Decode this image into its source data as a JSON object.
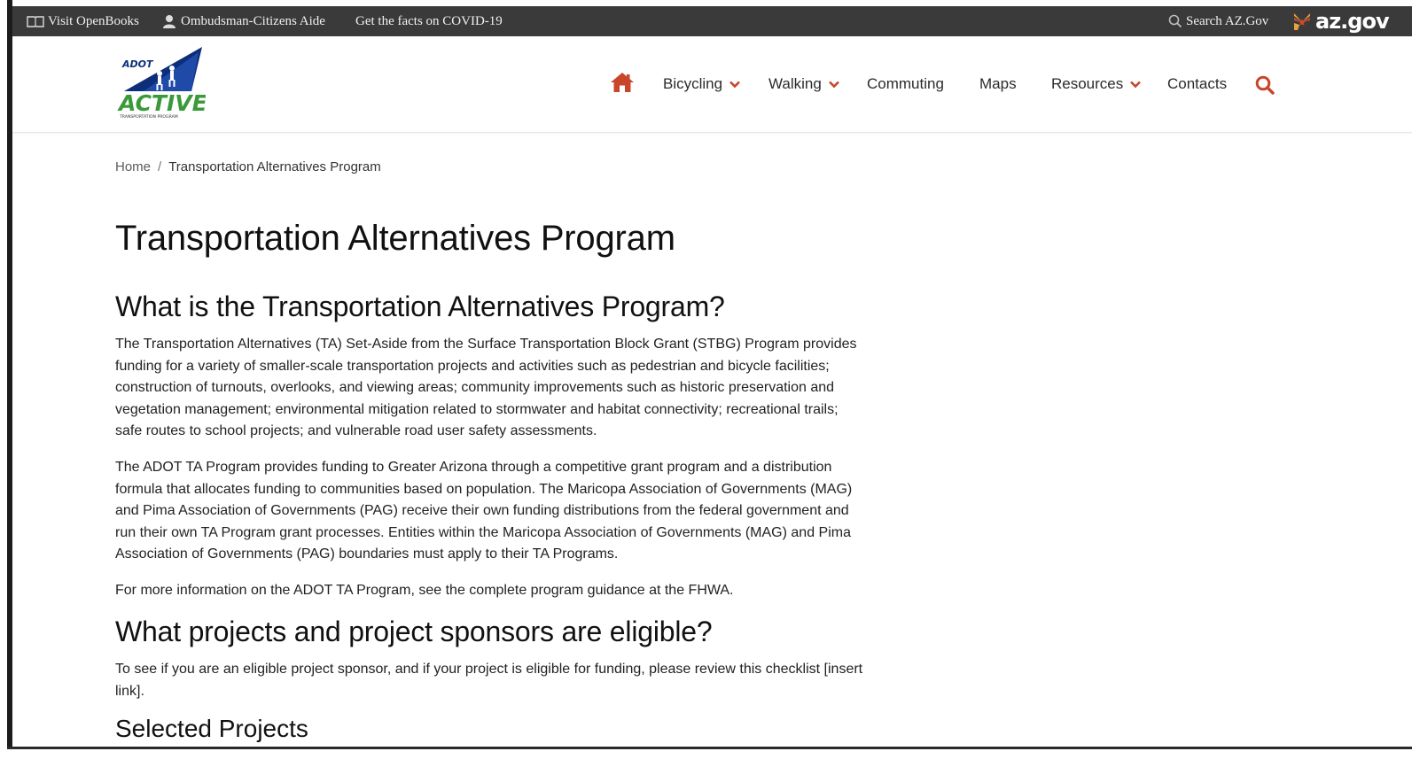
{
  "topbar": {
    "openbooks": "Visit OpenBooks",
    "ombudsman": "Ombudsman-Citizens Aide",
    "covid": "Get the facts on COVID-19",
    "search": "Search AZ.Gov",
    "azgov": "az.gov"
  },
  "logo": {
    "top": "ADOT",
    "main": "ACTIVE",
    "tagline": "TRANSPORTATION PROGRAM"
  },
  "nav": {
    "home_icon": "home-icon",
    "items": [
      {
        "label": "Bicycling",
        "dropdown": true
      },
      {
        "label": "Walking",
        "dropdown": true
      },
      {
        "label": "Commuting",
        "dropdown": false
      },
      {
        "label": "Maps",
        "dropdown": false
      },
      {
        "label": "Resources",
        "dropdown": true
      },
      {
        "label": "Contacts",
        "dropdown": false
      }
    ],
    "search_icon": "search-icon",
    "accent_color": "#c8462a"
  },
  "breadcrumb": {
    "home": "Home",
    "separator": "/",
    "current": "Transportation Alternatives Program"
  },
  "content": {
    "title": "Transportation Alternatives Program",
    "section1": {
      "heading": "What is the Transportation Alternatives Program?",
      "p1_lines": [
        "The Transportation Alternatives (TA) Set-Aside from the Surface Transportation Block Grant (STBG) Program provides",
        "funding for a variety of smaller-scale transportation projects and activities such as pedestrian and bicycle facilities;",
        "construction of turnouts, overlooks, and viewing areas; community improvements such as historic preservation and",
        "vegetation management; environmental mitigation related to stormwater and habitat connectivity; recreational trails;",
        "safe routes to school projects; and vulnerable road user safety assessments."
      ],
      "p2_lines": [
        "The ADOT TA Program provides funding to Greater Arizona through a competitive grant program and a distribution",
        "formula that allocates funding to communities based on population. The Maricopa Association of Governments (MAG)",
        "and Pima Association of Governments (PAG) receive their own funding distributions from the federal government and",
        "run their own TA Program grant processes. Entities within the Maricopa Association of Governments (MAG) and Pima",
        "Association of Governments (PAG) boundaries must apply to their TA Programs."
      ],
      "p3": "For more information on the ADOT TA Program, see the complete program guidance at the FHWA."
    },
    "section2": {
      "heading": "What projects and project sponsors are eligible?",
      "p_lines": [
        "To see if you are an eligible project sponsor, and if your project is eligible for funding, please review this checklist [insert",
        "link]."
      ]
    },
    "section3": {
      "heading": "Selected Projects"
    }
  }
}
